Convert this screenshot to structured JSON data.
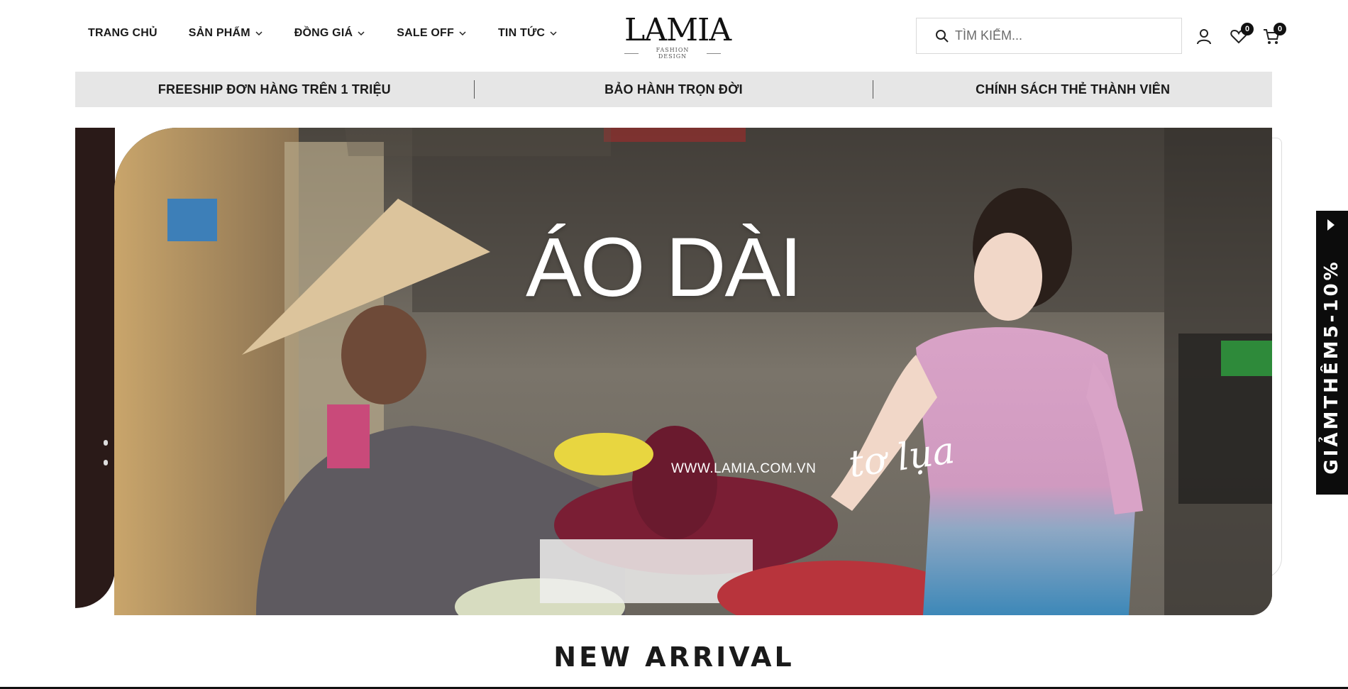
{
  "header": {
    "nav": [
      {
        "label": "TRANG CHỦ",
        "has_dropdown": false
      },
      {
        "label": "SẢN PHẨM",
        "has_dropdown": true
      },
      {
        "label": "ĐỒNG GIÁ",
        "has_dropdown": true
      },
      {
        "label": "SALE OFF",
        "has_dropdown": true
      },
      {
        "label": "TIN TỨC",
        "has_dropdown": true
      }
    ],
    "logo": {
      "main": "LAMIA",
      "sub": "FASHION DESIGN"
    },
    "search": {
      "placeholder": "TÌM KIẾM...",
      "value": "",
      "icon": "search-icon"
    },
    "icons": {
      "account": "user-icon",
      "wishlist": {
        "icon": "heart-icon",
        "count": "0"
      },
      "cart": {
        "icon": "cart-icon",
        "count": "0"
      }
    }
  },
  "promo_bar": {
    "items": [
      "FREESHIP ĐƠN HÀNG TRÊN 1 TRIỆU",
      "BẢO HÀNH TRỌN ĐỜI",
      "CHÍNH SÁCH THẺ THÀNH VIÊN"
    ]
  },
  "banner": {
    "title": "ÁO DÀI",
    "url": "WWW.LAMIA.COM.VN",
    "script": "tơ lụa",
    "next_icon": "chevron-right-icon"
  },
  "side_tab": {
    "label": "GIẢMTHÊM5-10%",
    "icon": "play-icon"
  },
  "section": {
    "title": "NEW ARRIVAL"
  },
  "colors": {
    "promo_bg": "#e6e6e6",
    "badge": "#111111",
    "side_tab_bg": "#0c0c0c",
    "text": "#1a1a1a"
  }
}
